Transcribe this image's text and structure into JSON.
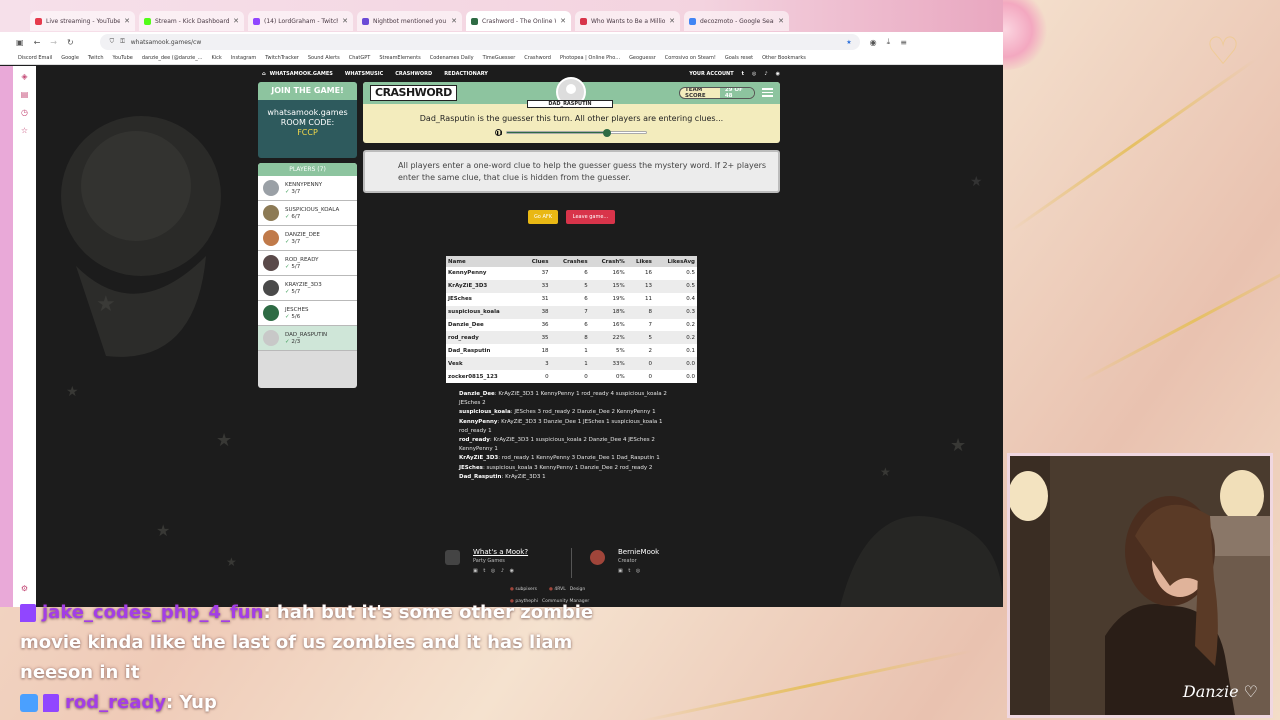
{
  "browser": {
    "tabs": [
      {
        "label": "Live streaming - YouTube Studi",
        "color": "#e63b4d",
        "active": false
      },
      {
        "label": "Stream - Kick Dashboard",
        "color": "#53fc18",
        "active": false
      },
      {
        "label": "(14) LordGraham - Twitch",
        "color": "#9146ff",
        "active": false
      },
      {
        "label": "Nightbot mentioned you",
        "color": "#6b4bd6",
        "active": false
      },
      {
        "label": "Crashword - The Online Word",
        "color": "#2e6b44",
        "active": true
      },
      {
        "label": "Who Wants to Be a Million",
        "color": "#d8344a",
        "active": false
      },
      {
        "label": "decozmoto - Google Search",
        "color": "#4285f4",
        "active": false
      }
    ],
    "url": "whatsamook.games/cw",
    "bookmarks": [
      "Discord Email",
      "Google",
      "Twitch",
      "YouTube",
      "danzie_dee (@danzie_...",
      "Kick",
      "Instagram",
      "TwitchTracker",
      "Sound Alerts",
      "ChatGPT",
      "StreamElements",
      "Codenames Daily",
      "TimeGuesser",
      "Crashword",
      "Photopea | Online Pho...",
      "Geoguessr",
      "Corrosivo on Steam!",
      "Goals reset",
      "Other Bookmarks"
    ]
  },
  "site_nav": {
    "items": [
      "WHATSAMOOK.GAMES",
      "WHATSMUSIC",
      "CRASHWORD",
      "REDACTIONARY"
    ],
    "account": "YOUR ACCOUNT"
  },
  "join": {
    "title": "JOIN THE GAME!",
    "site": "whatsamook.games",
    "room_label": "ROOM CODE:",
    "room_code": "FCCP"
  },
  "players": {
    "header": "PLAYERS (7)",
    "list": [
      {
        "name": "KENNYPENNY",
        "score": "3/7",
        "color": "#9aa0a6"
      },
      {
        "name": "SUSPICIOUS_KOALA",
        "score": "6/7",
        "color": "#8c7a55"
      },
      {
        "name": "DANZIE_DEE",
        "score": "3/7",
        "color": "#c07a4a"
      },
      {
        "name": "ROD_READY",
        "score": "5/7",
        "color": "#5a4a4a"
      },
      {
        "name": "KRAYZIE_3D3",
        "score": "5/7",
        "color": "#4a4a4a"
      },
      {
        "name": "JESCHES",
        "score": "5/6",
        "color": "#2e6b44"
      },
      {
        "name": "DAD_RASPUTIN",
        "score": "2/3",
        "color": "#c8c8c8"
      }
    ]
  },
  "game": {
    "logo": "CRASHWORD",
    "current_player": "DAD_RASPUTIN",
    "team_score_label": "TEAM SCORE",
    "team_score": "29 OF 48",
    "turn_message": "Dad_Rasputin is the guesser this turn. All other players are entering clues...",
    "timer_fraction": 0.72,
    "instructions": "All players enter a one-word clue to help the guesser guess the mystery word. If 2+ players enter the same clue, that clue is hidden from the guesser.",
    "afk_label": "Go AFK",
    "leave_label": "Leave game..."
  },
  "stats": {
    "headers": [
      "Name",
      "Clues",
      "Crashes",
      "Crash%",
      "Likes",
      "LikesAvg"
    ],
    "rows": [
      [
        "KennyPenny",
        "37",
        "6",
        "16%",
        "16",
        "0.5"
      ],
      [
        "KrAyZiE_3D3",
        "33",
        "5",
        "15%",
        "13",
        "0.5"
      ],
      [
        "JESches",
        "31",
        "6",
        "19%",
        "11",
        "0.4"
      ],
      [
        "suspicious_koala",
        "38",
        "7",
        "18%",
        "8",
        "0.3"
      ],
      [
        "Danzie_Dee",
        "36",
        "6",
        "16%",
        "7",
        "0.2"
      ],
      [
        "rod_ready",
        "35",
        "8",
        "22%",
        "5",
        "0.2"
      ],
      [
        "Dad_Rasputin",
        "18",
        "1",
        "5%",
        "2",
        "0.1"
      ],
      [
        "Vesk",
        "3",
        "1",
        "33%",
        "0",
        "0.0"
      ],
      [
        "zocker0815_123",
        "0",
        "0",
        "0%",
        "0",
        "0.0"
      ]
    ]
  },
  "clues": [
    {
      "name": "Danzie_Dee",
      "text": ": KrAyZiE_3D3 1 KennyPenny 1 rod_ready 4 suspicious_koala 2 JESches 2"
    },
    {
      "name": "suspicious_koala",
      "text": ": JESches 3 rod_ready 2 Danzie_Dee 2 KennyPenny 1"
    },
    {
      "name": "KennyPenny",
      "text": ": KrAyZiE_3D3 3 Danzie_Dee 1 JESches 1 suspicious_koala 1 rod_ready 1"
    },
    {
      "name": "rod_ready",
      "text": ": KrAyZiE_3D3 1 suspicious_koala 2 Danzie_Dee 4 JESches 2 KennyPenny 1"
    },
    {
      "name": "KrAyZiE_3D3",
      "text": ": rod_ready 1 KennyPenny 3 Danzie_Dee 1 Dad_Rasputin 1"
    },
    {
      "name": "JESches",
      "text": ": suspicious_koala 3 KennyPenny 1 Danzie_Dee 2 rod_ready 2"
    },
    {
      "name": "Dad_Rasputin",
      "text": ": KrAyZiE_3D3 1"
    }
  ],
  "footer": {
    "whats_title": "What's a Mook?",
    "whats_sub": "Party Games",
    "creator_name": "BernieMook",
    "creator_role": "Creator",
    "credits": [
      {
        "name": "subpixers",
        "role": ""
      },
      {
        "name": "4RVL",
        "role": "Design"
      },
      {
        "name": "paythephi",
        "role": "Community Manager"
      }
    ]
  },
  "chat": {
    "line1_user": "jake_codes_php_4_fun",
    "line1_text": ": hah but it's some other zombie movie kinda like the last of us zombies and it has liam neeson in it",
    "line2_user": "rod_ready",
    "line2_text": ": Yup"
  },
  "overlay": {
    "signature": "Danzie"
  },
  "colors": {
    "accent_green": "#8dc49f",
    "dark_teal": "#2e5a5d",
    "cream": "#f3ecbd",
    "afk_yellow": "#e9b814",
    "leave_red": "#d8344a",
    "chat_user": "#a33ee6"
  }
}
